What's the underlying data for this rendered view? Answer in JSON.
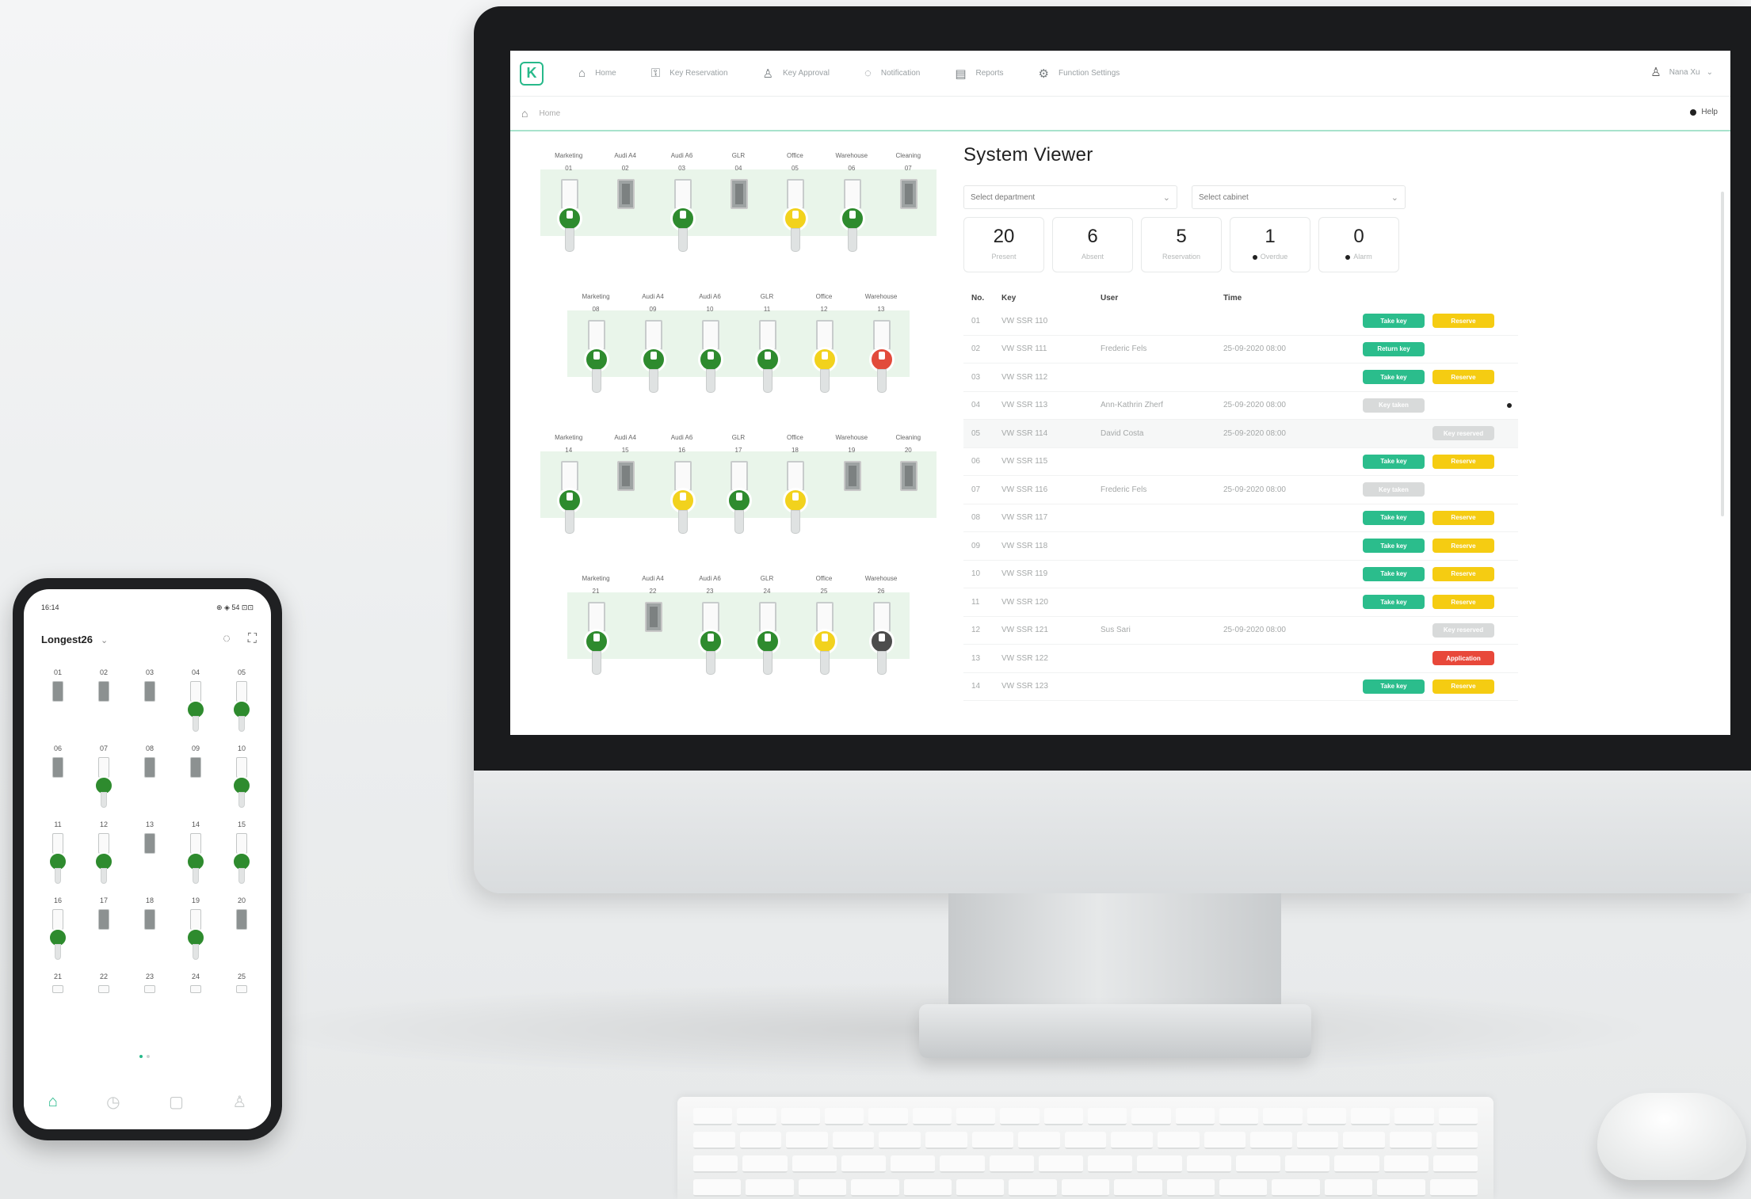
{
  "nav": {
    "items": [
      {
        "label": "Home",
        "icon": "home-icon"
      },
      {
        "label": "Key Reservation",
        "icon": "key-icon"
      },
      {
        "label": "Key Approval",
        "icon": "user-icon"
      },
      {
        "label": "Notification",
        "icon": "chat-icon"
      },
      {
        "label": "Reports",
        "icon": "report-icon"
      },
      {
        "label": "Function Settings",
        "icon": "gear-icon"
      }
    ],
    "user": "Nana Xu",
    "breadcrumb": "Home",
    "help": "Help"
  },
  "cabinets": [
    {
      "labels": [
        "Marketing",
        "Audi A4",
        "Audi A6",
        "GLR",
        "Office",
        "Warehouse",
        "Cleaning"
      ],
      "slots": [
        {
          "n": "01",
          "s": "green"
        },
        {
          "n": "02",
          "s": "empty"
        },
        {
          "n": "03",
          "s": "green"
        },
        {
          "n": "04",
          "s": "empty"
        },
        {
          "n": "05",
          "s": "yellow"
        },
        {
          "n": "06",
          "s": "green"
        },
        {
          "n": "07",
          "s": "empty"
        }
      ]
    },
    {
      "labels": [
        "Marketing",
        "Audi A4",
        "Audi A6",
        "GLR",
        "Office",
        "Warehouse"
      ],
      "slots": [
        {
          "n": "08",
          "s": "green"
        },
        {
          "n": "09",
          "s": "green"
        },
        {
          "n": "10",
          "s": "green"
        },
        {
          "n": "11",
          "s": "green"
        },
        {
          "n": "12",
          "s": "yellow"
        },
        {
          "n": "13",
          "s": "red"
        }
      ]
    },
    {
      "labels": [
        "Marketing",
        "Audi A4",
        "Audi A6",
        "GLR",
        "Office",
        "Warehouse",
        "Cleaning"
      ],
      "slots": [
        {
          "n": "14",
          "s": "green"
        },
        {
          "n": "15",
          "s": "empty"
        },
        {
          "n": "16",
          "s": "yellow"
        },
        {
          "n": "17",
          "s": "green"
        },
        {
          "n": "18",
          "s": "yellow"
        },
        {
          "n": "19",
          "s": "empty"
        },
        {
          "n": "20",
          "s": "empty"
        }
      ]
    },
    {
      "labels": [
        "Marketing",
        "Audi A4",
        "Audi A6",
        "GLR",
        "Office",
        "Warehouse"
      ],
      "slots": [
        {
          "n": "21",
          "s": "green"
        },
        {
          "n": "22",
          "s": "empty"
        },
        {
          "n": "23",
          "s": "green"
        },
        {
          "n": "24",
          "s": "green"
        },
        {
          "n": "25",
          "s": "yellow"
        },
        {
          "n": "26",
          "s": "dark"
        }
      ]
    }
  ],
  "viewer": {
    "title": "System Viewer",
    "department_placeholder": "Select department",
    "cabinet_placeholder": "Select cabinet",
    "stats": [
      {
        "value": "20",
        "label": "Present",
        "dot": false
      },
      {
        "value": "6",
        "label": "Absent",
        "dot": false
      },
      {
        "value": "5",
        "label": "Reservation",
        "dot": false
      },
      {
        "value": "1",
        "label": "Overdue",
        "dot": true
      },
      {
        "value": "0",
        "label": "Alarm",
        "dot": true
      }
    ],
    "columns": [
      "No.",
      "Key",
      "User",
      "Time"
    ],
    "rows": [
      {
        "no": "01",
        "key": "VW SSR 110",
        "user": "",
        "time": "",
        "actions": [
          "Take key",
          "Reserve"
        ]
      },
      {
        "no": "02",
        "key": "VW SSR 111",
        "user": "Frederic Fels",
        "time": "25-09-2020  08:00",
        "actions": [
          "Return key"
        ]
      },
      {
        "no": "03",
        "key": "VW SSR 112",
        "user": "",
        "time": "",
        "actions": [
          "Take key",
          "Reserve"
        ]
      },
      {
        "no": "04",
        "key": "VW SSR 113",
        "user": "Ann-Kathrin Zherf",
        "time": "25-09-2020  08:00",
        "actions": [
          "Key taken"
        ],
        "dot": true
      },
      {
        "no": "05",
        "key": "VW SSR 114",
        "user": "David Costa",
        "time": "25-09-2020  08:00",
        "actions": [
          "Key reserved"
        ],
        "hl": true
      },
      {
        "no": "06",
        "key": "VW SSR 115",
        "user": "",
        "time": "",
        "actions": [
          "Take key",
          "Reserve"
        ]
      },
      {
        "no": "07",
        "key": "VW SSR 116",
        "user": "Frederic Fels",
        "time": "25-09-2020  08:00",
        "actions": [
          "Key taken"
        ]
      },
      {
        "no": "08",
        "key": "VW SSR 117",
        "user": "",
        "time": "",
        "actions": [
          "Take key",
          "Reserve"
        ]
      },
      {
        "no": "09",
        "key": "VW SSR 118",
        "user": "",
        "time": "",
        "actions": [
          "Take key",
          "Reserve"
        ]
      },
      {
        "no": "10",
        "key": "VW SSR 119",
        "user": "",
        "time": "",
        "actions": [
          "Take key",
          "Reserve"
        ]
      },
      {
        "no": "11",
        "key": "VW SSR 120",
        "user": "",
        "time": "",
        "actions": [
          "Take key",
          "Reserve"
        ]
      },
      {
        "no": "12",
        "key": "VW SSR 121",
        "user": "Sus Sari",
        "time": "25-09-2020  08:00",
        "actions": [
          "Key reserved"
        ]
      },
      {
        "no": "13",
        "key": "VW SSR 122",
        "user": "",
        "time": "",
        "actions": [
          "Application"
        ]
      },
      {
        "no": "14",
        "key": "VW SSR 123",
        "user": "",
        "time": "",
        "actions": [
          "Take key",
          "Reserve"
        ]
      }
    ]
  },
  "phone": {
    "time": "16:14",
    "status_icons": "⊕ ◈ 54 ⊡⊡",
    "title": "Longest26",
    "slots": [
      {
        "n": "01",
        "k": false
      },
      {
        "n": "02",
        "k": false
      },
      {
        "n": "03",
        "k": false
      },
      {
        "n": "04",
        "k": true
      },
      {
        "n": "05",
        "k": true
      },
      {
        "n": "06",
        "k": false
      },
      {
        "n": "07",
        "k": true
      },
      {
        "n": "08",
        "k": false
      },
      {
        "n": "09",
        "k": false
      },
      {
        "n": "10",
        "k": true
      },
      {
        "n": "11",
        "k": true
      },
      {
        "n": "12",
        "k": true
      },
      {
        "n": "13",
        "k": false
      },
      {
        "n": "14",
        "k": true
      },
      {
        "n": "15",
        "k": true
      },
      {
        "n": "16",
        "k": true
      },
      {
        "n": "17",
        "k": false
      },
      {
        "n": "18",
        "k": false
      },
      {
        "n": "19",
        "k": true
      },
      {
        "n": "20",
        "k": false
      },
      {
        "n": "21",
        "k": false
      },
      {
        "n": "22",
        "k": false
      },
      {
        "n": "23",
        "k": false
      },
      {
        "n": "24",
        "k": false
      },
      {
        "n": "25",
        "k": false
      }
    ]
  },
  "colors": {
    "accent": "#27b98a",
    "green": "#2e8b2e",
    "yellow": "#f2d21d",
    "red": "#e24b3b"
  }
}
